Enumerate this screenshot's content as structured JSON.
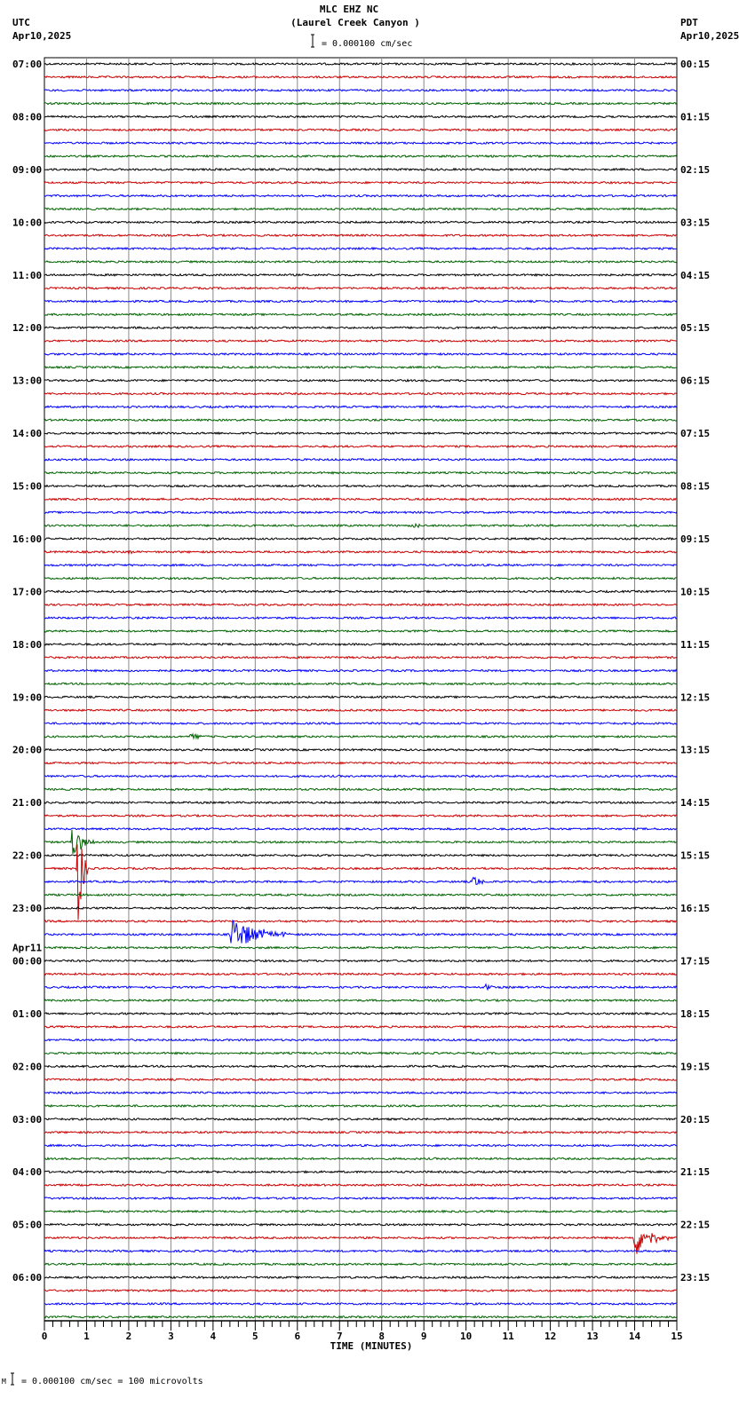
{
  "header": {
    "station": "MLC EHZ NC",
    "location": "(Laurel Creek Canyon )",
    "left_tz": "UTC",
    "left_date": "Apr10,2025",
    "right_tz": "PDT",
    "right_date": "Apr10,2025",
    "scale": "= 0.000100 cm/sec"
  },
  "footer": {
    "scale": "= 0.000100 cm/sec =     100 microvolts"
  },
  "chart_data": {
    "type": "line",
    "title": "MLC EHZ NC (Laurel Creek Canyon )",
    "xlabel": "TIME (MINUTES)",
    "xlim": [
      0,
      15
    ],
    "x_ticks": [
      "0",
      "1",
      "2",
      "3",
      "4",
      "5",
      "6",
      "7",
      "8",
      "9",
      "10",
      "11",
      "12",
      "13",
      "14",
      "15"
    ],
    "traces_per_hour": 4,
    "trace_colors": [
      "#000000",
      "#cc0000",
      "#0000ff",
      "#006400"
    ],
    "left_labels": [
      "07:00",
      "08:00",
      "09:00",
      "10:00",
      "11:00",
      "12:00",
      "13:00",
      "14:00",
      "15:00",
      "16:00",
      "17:00",
      "18:00",
      "19:00",
      "20:00",
      "21:00",
      "22:00",
      "23:00",
      "00:00",
      "01:00",
      "02:00",
      "03:00",
      "04:00",
      "05:00",
      "06:00"
    ],
    "date_change_label": "Apr11",
    "right_labels": [
      "00:15",
      "01:15",
      "02:15",
      "03:15",
      "04:15",
      "05:15",
      "06:15",
      "07:15",
      "08:15",
      "09:15",
      "10:15",
      "11:15",
      "12:15",
      "13:15",
      "14:15",
      "15:15",
      "16:15",
      "17:15",
      "18:15",
      "19:15",
      "20:15",
      "21:15",
      "22:15",
      "23:15"
    ],
    "events": [
      {
        "trace": 61,
        "minute": 0.8,
        "amplitude": 4.5,
        "duration": 0.25
      },
      {
        "trace": 59,
        "minute": 0.7,
        "amplitude": 1.0,
        "duration": 0.6
      },
      {
        "trace": 66,
        "minute": 4.45,
        "amplitude": 1.3,
        "duration": 1.4
      },
      {
        "trace": 62,
        "minute": 10.2,
        "amplitude": 0.5,
        "duration": 0.3
      },
      {
        "trace": 89,
        "minute": 14.0,
        "amplitude": 1.5,
        "duration": 0.8
      },
      {
        "trace": 51,
        "minute": 3.5,
        "amplitude": 0.4,
        "duration": 0.3
      },
      {
        "trace": 35,
        "minute": 8.8,
        "amplitude": 0.2,
        "duration": 0.4
      },
      {
        "trace": 37,
        "minute": 2.0,
        "amplitude": 0.2,
        "duration": 0.3
      },
      {
        "trace": 70,
        "minute": 10.5,
        "amplitude": 0.3,
        "duration": 0.3
      }
    ]
  }
}
